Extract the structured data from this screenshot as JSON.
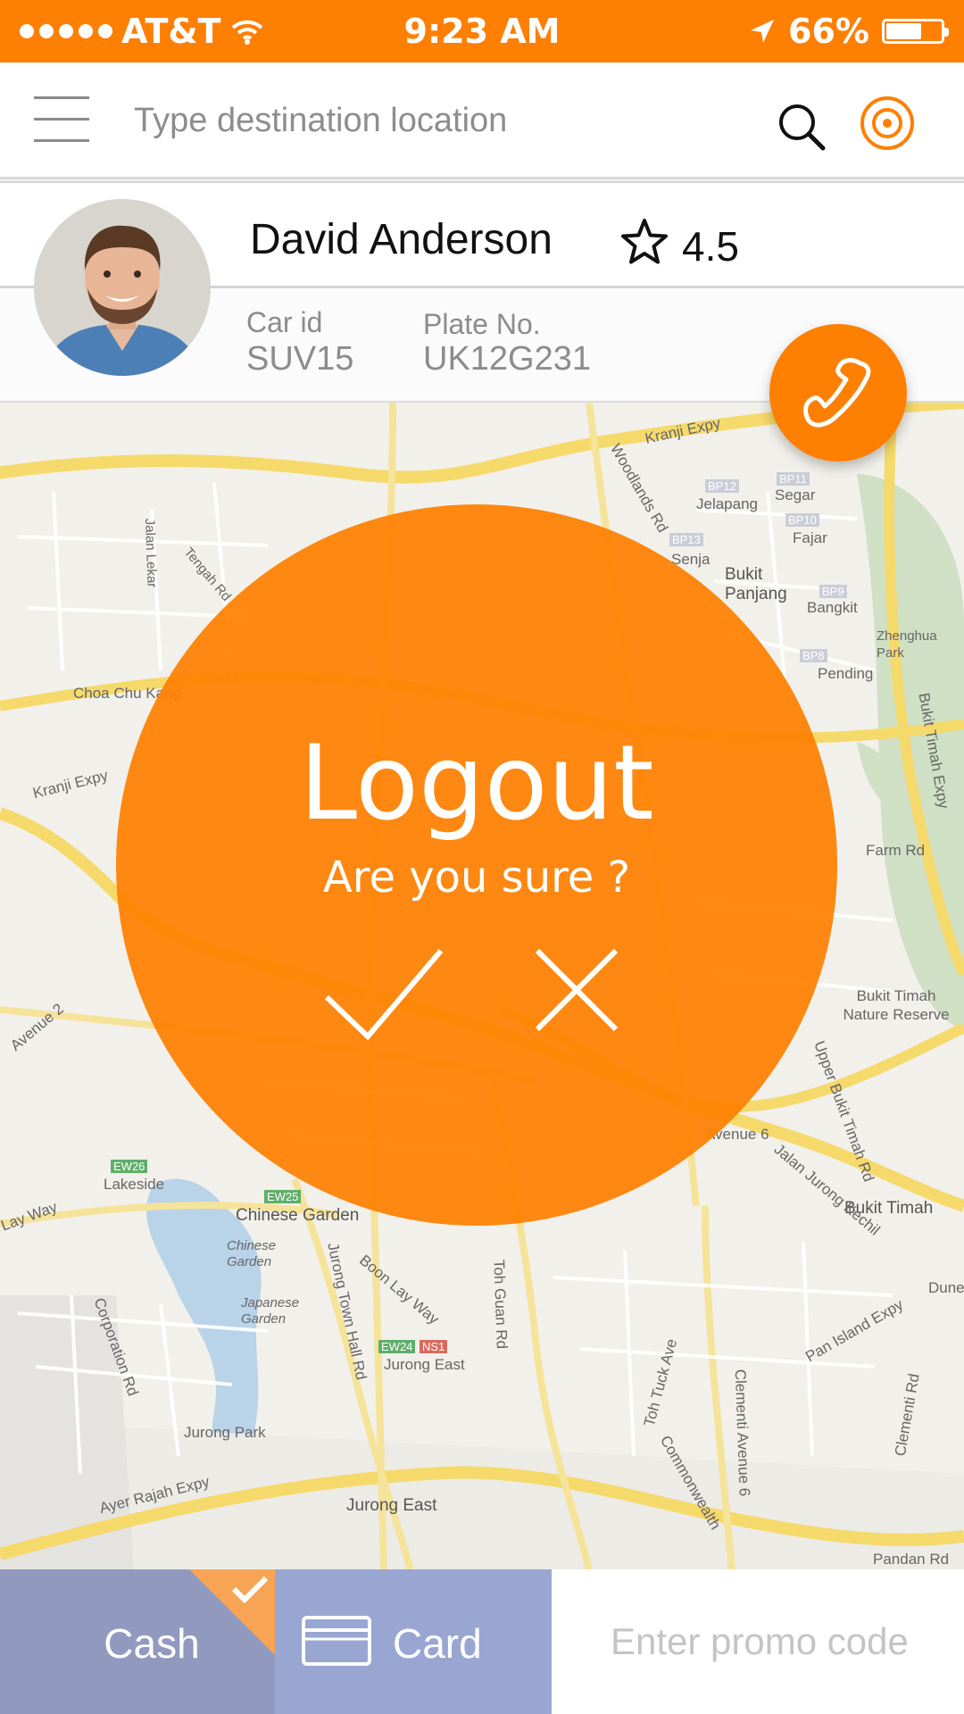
{
  "status_bar": {
    "carrier": "AT&T",
    "time": "9:23 AM",
    "battery": "66%",
    "battery_level": 0.66
  },
  "search": {
    "placeholder": "Type destination location",
    "value": ""
  },
  "driver": {
    "name": "David Anderson",
    "rating": "4.5",
    "car_id_label": "Car id",
    "car_id": "SUV15",
    "plate_label": "Plate No.",
    "plate_number": "UK12G231"
  },
  "map_labels": [
    "Kranji Expy",
    "Jelapang",
    "Segar",
    "Fajar",
    "Senja",
    "Bukit Panjang",
    "Bangkit",
    "Pending",
    "Zhenghua Park",
    "Bukit Timah Expy",
    "Choa Chu Kang",
    "Kranji Expy",
    "Bukit Timah Nature Reserve",
    "Farm Rd",
    "Woodlands Rd",
    "Lakeside",
    "Chinese Garden",
    "Chinese Garden",
    "Japanese Garden",
    "Jurong Park",
    "Jurong East",
    "Jurong East",
    "Boon Lay Way",
    "Toh Guan Rd",
    "Toh Tuck Ave",
    "Pan Island Expy",
    "Ayer Rajah Expy",
    "Corporation Rd",
    "Jurong Town Hall Rd",
    "Clementi Avenue 6",
    "Clementi Rd",
    "Bukit Timah",
    "Upper Bukit Timah Rd",
    "Jalan Jurong Kechil",
    "Commonwealth",
    "Pandan Rd",
    "Jalan Lekar",
    "Tengah Rd",
    "Lay Way",
    "Dunearn",
    "Avenue 2",
    "Avenue 6",
    "BP12",
    "BP11",
    "BP10",
    "BP13",
    "BP9",
    "BP8",
    "EW26",
    "EW25",
    "EW24",
    "NS1"
  ],
  "dialog": {
    "title": "Logout",
    "message": "Are you sure ?"
  },
  "payment": {
    "cash_label": "Cash",
    "card_label": "Card",
    "selected": "Cash",
    "promo_placeholder": "Enter promo code",
    "promo_value": ""
  },
  "colors": {
    "accent": "#ff7f00",
    "cash_tab": "#9199bf",
    "card_tab": "#9aa6d2",
    "selected_corner": "#f7a455"
  },
  "icons": {
    "menu": "hamburger-icon",
    "search": "search-icon",
    "location": "target-icon",
    "rating": "star-icon",
    "call": "phone-icon",
    "confirm": "check-icon",
    "cancel": "close-icon",
    "card": "credit-card-icon",
    "selected": "check-mark-icon"
  }
}
